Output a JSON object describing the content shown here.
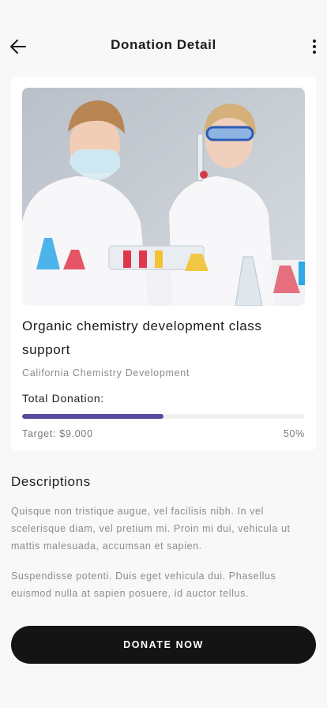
{
  "header": {
    "title": "Donation Detail",
    "back_icon": "arrow-left-icon",
    "more_icon": "more-vertical-icon"
  },
  "card": {
    "image_alt": "Two children in lab coats doing a chemistry experiment",
    "title": "Organic chemistry development class support",
    "organization": "California Chemistry Development",
    "total_label": "Total Donation:",
    "target": "Target: $9.000",
    "progress_percent_text": "50%",
    "progress_fraction": 0.5,
    "progress_color": "#564c9d"
  },
  "descriptions": {
    "heading": "Descriptions",
    "paragraphs": [
      "Quisque non tristique augue, vel facilisis nibh. In vel scelerisque diam, vel pretium mi. Proin mi dui, vehicula ut mattis malesuada, accumsan et sapien.",
      "Suspendisse potenti. Duis eget vehicula dui. Phasellus euismod nulla at sapien posuere, id auctor tellus."
    ]
  },
  "cta": {
    "label": "DONATE NOW"
  }
}
